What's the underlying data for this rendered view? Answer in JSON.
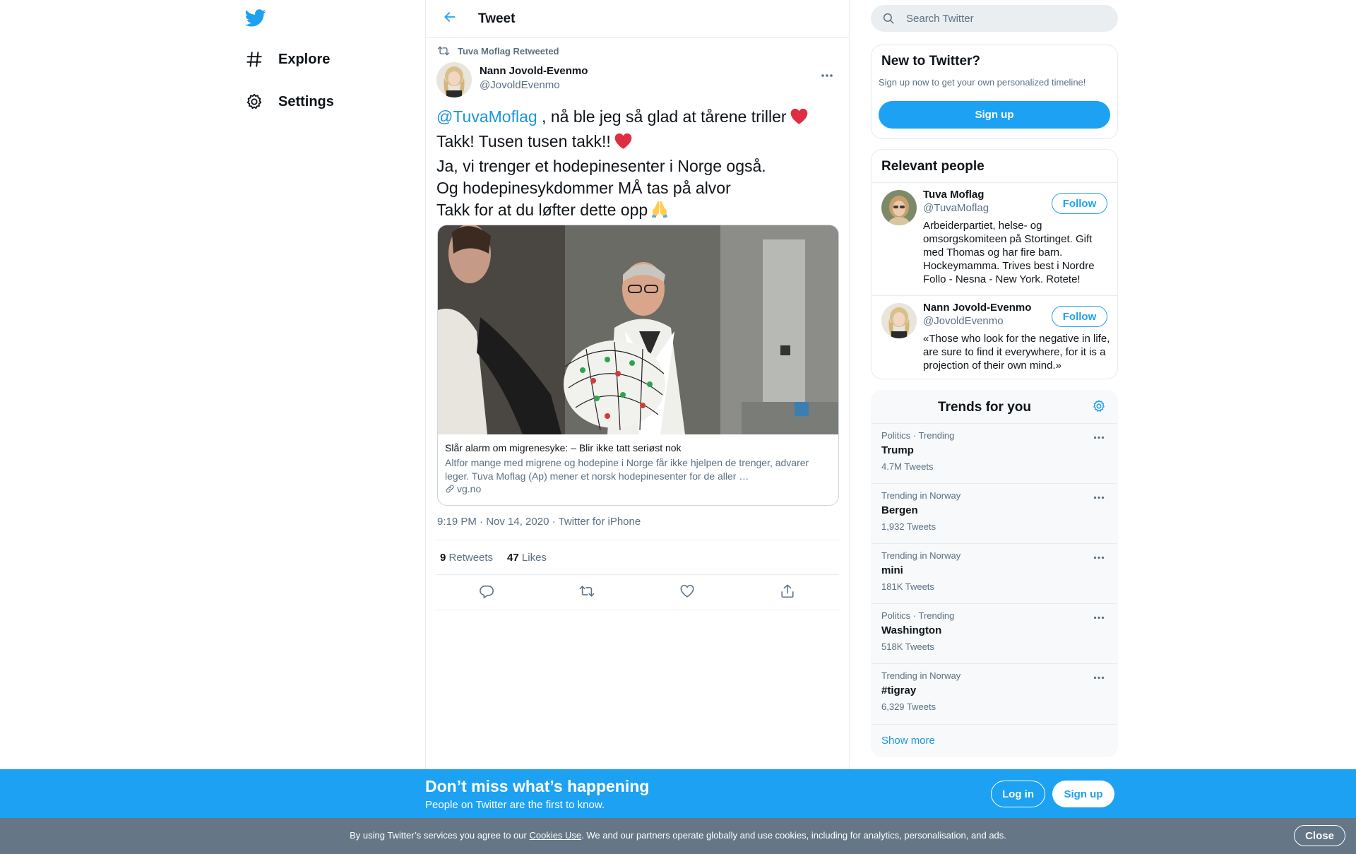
{
  "colors": {
    "brand_blue": "#1da1f2",
    "link_blue": "#1b95e0",
    "heart_red": "#e0245e",
    "secondary_text": "#5b7083",
    "cookie_bar": "#657786"
  },
  "nav": {
    "logo_icon": "twitter-bird-icon",
    "items": [
      {
        "label": "Explore",
        "icon": "hashtag-icon"
      },
      {
        "label": "Settings",
        "icon": "gear-icon"
      }
    ]
  },
  "main": {
    "header_title": "Tweet",
    "back_icon": "arrow-left-icon",
    "tweet": {
      "retweeted_by": "Tuva Moflag Retweeted",
      "author_name": "Nann Jovold-Evenmo",
      "author_handle": "@JovoldEvenmo",
      "mention": "@TuvaMoflag",
      "line1_rest": " , nå ble jeg så glad at tårene triller",
      "line2": "Takk! Tusen tusen takk!!",
      "line3": "Ja, vi trenger et hodepinesenter i Norge også.",
      "line4": "Og hodepinesykdommer MÅ tas på alvor",
      "line5": "Takk for at du løfter dette opp",
      "card": {
        "title": "Slår alarm om migrenesyke: – Blir ikke tatt seriøst nok",
        "description": "Altfor mange med migrene og hodepine i Norge får ikke hjelpen de trenger, advarer leger. Tuva Moflag (Ap) mener et norsk hodepinesenter for de aller …",
        "domain": "vg.no"
      },
      "timestamp": "9:19 PM · Nov 14, 2020 · Twitter for iPhone",
      "retweets_count": "9",
      "retweets_label": "Retweets",
      "likes_count": "47",
      "likes_label": "Likes"
    }
  },
  "sidebar": {
    "search_placeholder": "Search Twitter",
    "new_to_twitter": {
      "title": "New to Twitter?",
      "subtitle": "Sign up now to get your own personalized timeline!",
      "button": "Sign up"
    },
    "relevant_people": {
      "title": "Relevant people",
      "people": [
        {
          "name": "Tuva Moflag",
          "handle": "@TuvaMoflag",
          "bio": "Arbeiderpartiet, helse- og omsorgskomiteen på Stortinget. Gift med Thomas og har fire barn. Hockeymamma. Trives best i Nordre Follo - Nesna - New York. Rotete!",
          "follow_label": "Follow"
        },
        {
          "name": "Nann Jovold-Evenmo",
          "handle": "@JovoldEvenmo",
          "bio": "«Those who look for the negative in life, are sure to find it everywhere, for it is a projection of their own mind.»",
          "follow_label": "Follow"
        }
      ]
    },
    "trends": {
      "title": "Trends for you",
      "items": [
        {
          "meta": "Politics · Trending",
          "name": "Trump",
          "count": "4.7M Tweets"
        },
        {
          "meta": "Trending in Norway",
          "name": "Bergen",
          "count": "1,932 Tweets"
        },
        {
          "meta": "Trending in Norway",
          "name": "mini",
          "count": "181K Tweets"
        },
        {
          "meta": "Politics · Trending",
          "name": "Washington",
          "count": "518K Tweets"
        },
        {
          "meta": "Trending in Norway",
          "name": "#tigray",
          "count": "6,329 Tweets"
        }
      ],
      "show_more": "Show more"
    }
  },
  "banner": {
    "title": "Don’t miss what’s happening",
    "subtitle": "People on Twitter are the first to know.",
    "login": "Log in",
    "signup": "Sign up"
  },
  "cookie": {
    "text_before": "By using Twitter’s services you agree to our ",
    "link": "Cookies Use",
    "text_after": ". We and our partners operate globally and use cookies, including for analytics, personalisation, and ads.",
    "close": "Close"
  }
}
